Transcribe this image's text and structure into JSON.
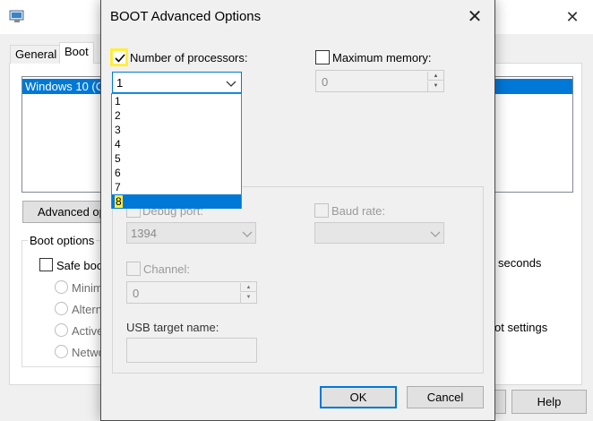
{
  "background_window": {
    "tabs": [
      {
        "label": "General"
      },
      {
        "label": "Boot"
      }
    ],
    "os_list": {
      "selected_entry": "Windows 10 (C"
    },
    "advanced_button_label": "Advanced op",
    "boot_options": {
      "group_label": "Boot options",
      "safe_boot_label": "Safe boo",
      "radios": [
        "Minim",
        "Altern",
        "Active",
        "Netwo"
      ]
    },
    "timeout_unit": "seconds",
    "boot_settings_label": "ot settings",
    "help_button_label": "Help"
  },
  "dialog": {
    "title": "BOOT Advanced Options",
    "number_of_processors": {
      "label": "Number of processors:",
      "checked": true,
      "selected_value": "1",
      "options": [
        "1",
        "2",
        "3",
        "4",
        "5",
        "6",
        "7",
        "8"
      ],
      "highlighted_option": "8"
    },
    "maximum_memory": {
      "label": "Maximum memory:",
      "checked": false,
      "value": "0"
    },
    "debug": {
      "debug_port_label": "Debug port:",
      "debug_port_value": "1394",
      "baud_rate_label": "Baud rate:",
      "channel_label": "Channel:",
      "channel_value": "0",
      "usb_target_label": "USB target name:"
    },
    "ok_label": "OK",
    "cancel_label": "Cancel"
  },
  "colors": {
    "accent": "#0078d7",
    "highlight": "#ffef3a",
    "dialog_bg": "#f0f0f0"
  }
}
